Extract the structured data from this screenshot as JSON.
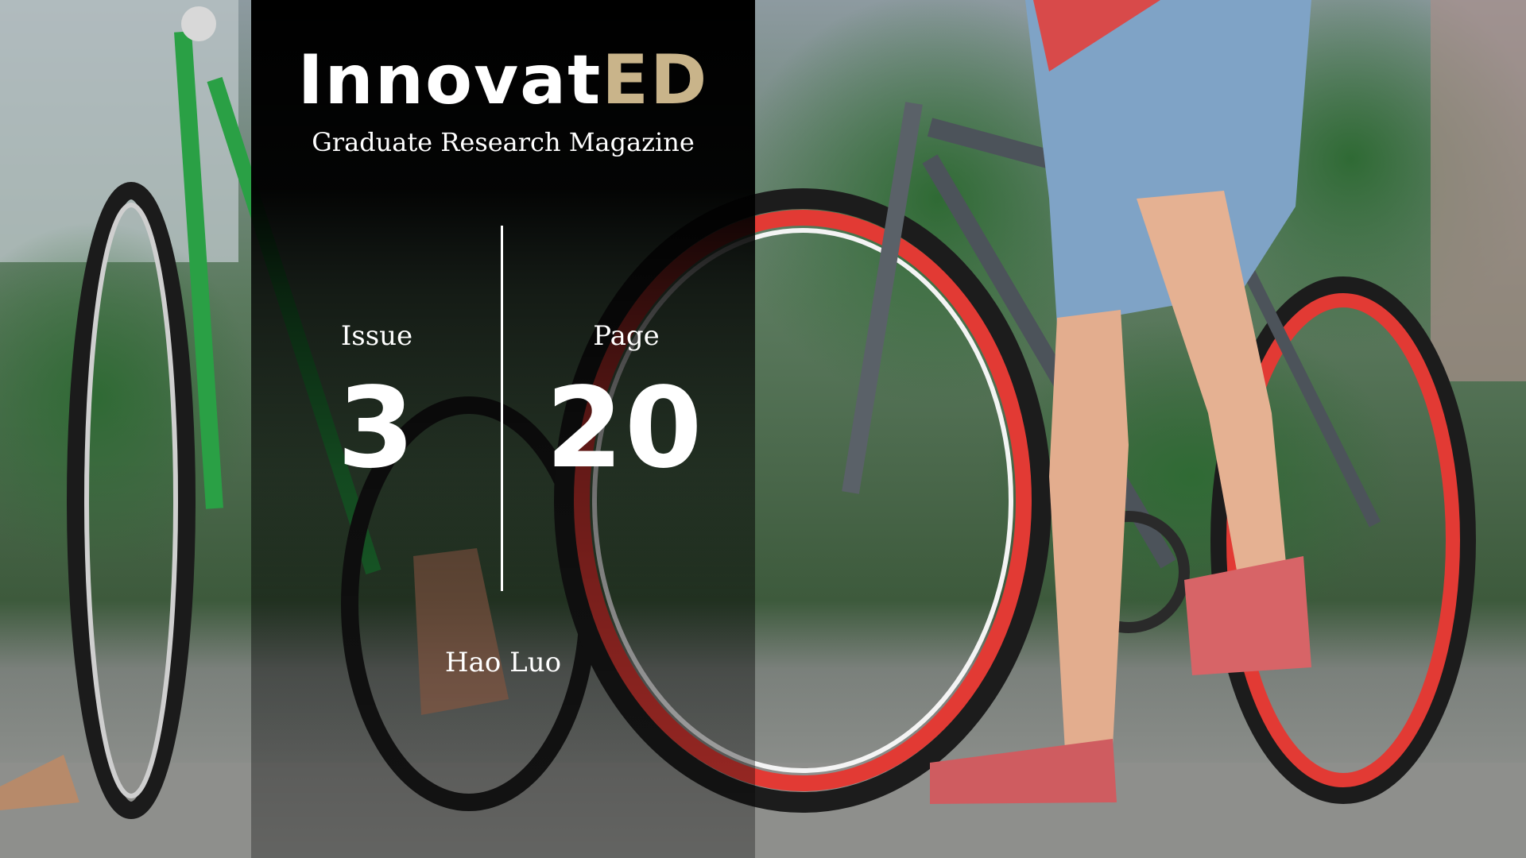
{
  "cover": {
    "logo": {
      "part1": "Innovat",
      "part2": "ED"
    },
    "subtitle": "Graduate Research Magazine",
    "issue_label": "Issue",
    "issue_number": "3",
    "page_label": "Page",
    "page_number": "20",
    "author": "Hao Luo"
  },
  "colors": {
    "logo_accent": "#c9b48a",
    "panel_background": "#000000",
    "text": "#ffffff"
  }
}
